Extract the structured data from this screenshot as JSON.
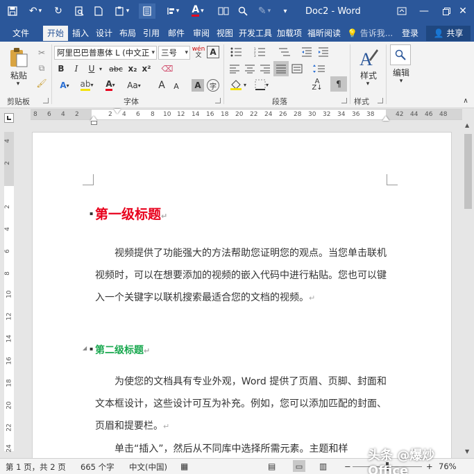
{
  "window": {
    "title": "Doc2 - Word",
    "accent": "#2b579a"
  },
  "quick_access": [
    "save-icon",
    "undo-icon",
    "redo-icon",
    "print-preview-icon",
    "new-doc-icon",
    "paste-icon",
    "view-icon",
    "paragraph-icon",
    "font-color-icon",
    "layout-icon",
    "find-icon",
    "draw-icon",
    "dropdown-icon"
  ],
  "tabs": [
    {
      "label": "文件"
    },
    {
      "label": "开始"
    },
    {
      "label": "插入"
    },
    {
      "label": "设计"
    },
    {
      "label": "布局"
    },
    {
      "label": "引用"
    },
    {
      "label": "邮件"
    },
    {
      "label": "审阅"
    },
    {
      "label": "视图"
    },
    {
      "label": "开发工具"
    },
    {
      "label": "加载项"
    },
    {
      "label": "福昕阅读"
    }
  ],
  "tell_me": "告诉我...",
  "account": {
    "signin": "登录",
    "share": "共享"
  },
  "ribbon": {
    "clipboard": {
      "paste": "粘贴",
      "label": "剪贴板"
    },
    "font": {
      "name": "阿里巴巴普惠体 L (中文正",
      "size": "三号",
      "label": "字体",
      "phonetic": "wén",
      "bold": "B",
      "italic": "I",
      "underline": "U",
      "strike": "abc",
      "sub": "x₂",
      "sup": "x²",
      "case": "Aa",
      "grow": "A",
      "shrink": "A",
      "char_shading": "A",
      "enclose": "字"
    },
    "paragraph": {
      "label": "段落"
    },
    "styles": {
      "label": "样式",
      "button": "样式"
    },
    "editing": {
      "button": "编辑"
    }
  },
  "ruler": {
    "h_ticks": [
      "8",
      "6",
      "4",
      "2",
      "2",
      "4",
      "6",
      "8",
      "10",
      "12",
      "14",
      "16",
      "18",
      "20",
      "22",
      "24",
      "26",
      "28",
      "30",
      "32",
      "34",
      "36",
      "38",
      "42",
      "44",
      "46",
      "48"
    ],
    "v_ticks": [
      "4",
      "2",
      "2",
      "4",
      "6",
      "8",
      "10",
      "12",
      "14",
      "16",
      "18",
      "20",
      "22",
      "24"
    ]
  },
  "document": {
    "heading1": "第一级标题",
    "heading1_color": "#e8001c",
    "para1": "视频提供了功能强大的方法帮助您证明您的观点。当您单击联机视频时，可以在想要添加的视频的嵌入代码中进行粘贴。您也可以键入一个关键字以联机搜索最适合您的文档的视频。",
    "heading2": "第二级标题",
    "heading2_color": "#19a84f",
    "para2": "为使您的文档具有专业外观，Word 提供了页眉、页脚、封面和文本框设计，这些设计可互为补充。例如，您可以添加匹配的封面、页眉和提要栏。",
    "para3": "单击“插入”，然后从不同库中选择所需元素。主题和样"
  },
  "status": {
    "page": "第 1 页，共 2 页",
    "words": "665 个字",
    "lang": "中文(中国)",
    "zoom": "76%"
  },
  "watermark": "头条 @爆炒Office"
}
